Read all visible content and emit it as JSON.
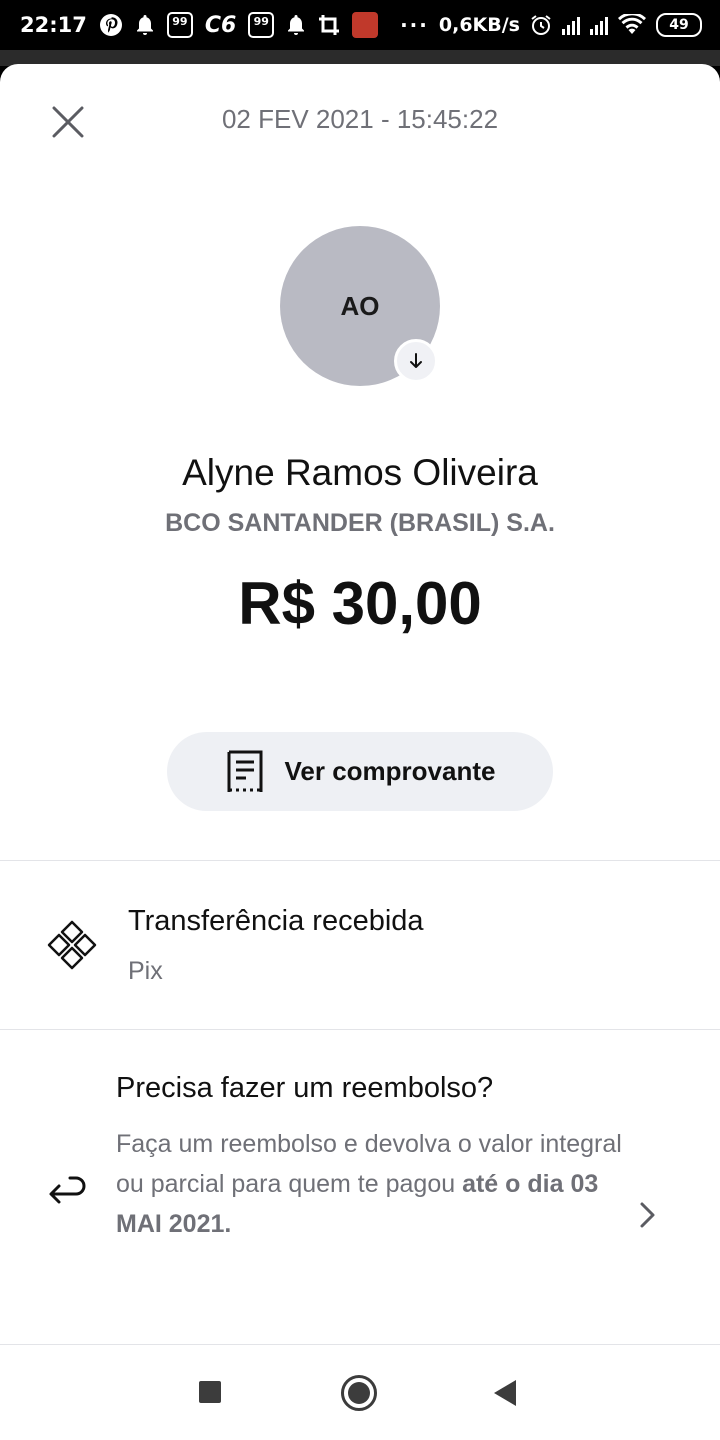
{
  "status_bar": {
    "time": "22:17",
    "app_box_1": "99",
    "carrier": "C6",
    "app_box_2": "99",
    "dots": "···",
    "speed": "0,6KB/s",
    "battery": "49"
  },
  "header": {
    "date": "02 FEV 2021 - 15:45:22"
  },
  "contact": {
    "initials": "AO",
    "name": "Alyne Ramos Oliveira",
    "bank": "BCO SANTANDER (BRASIL) S.A.",
    "amount": "R$ 30,00"
  },
  "actions": {
    "receipt_label": "Ver comprovante"
  },
  "transaction": {
    "title": "Transferência recebida",
    "method": "Pix"
  },
  "refund": {
    "title": "Precisa fazer um reembolso?",
    "body": "Faça um reembolso e devolva o valor integral ou parcial para quem te pagou ",
    "deadline": "até o dia 03 MAI 2021."
  },
  "colors": {
    "avatar": "#b9bac3",
    "secondary_text": "#6f7077",
    "button_bg": "#eef0f4"
  }
}
